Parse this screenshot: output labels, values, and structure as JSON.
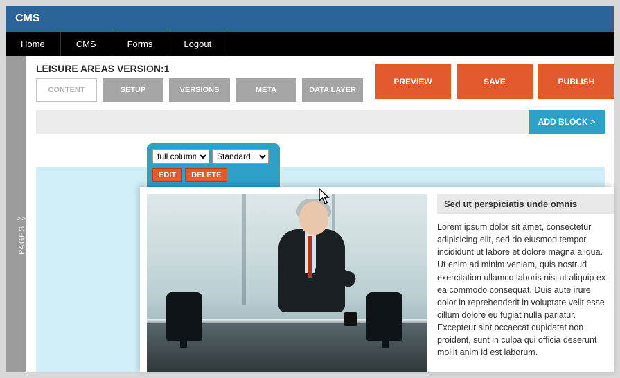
{
  "header": {
    "brand": "CMS"
  },
  "nav": {
    "items": [
      "Home",
      "CMS",
      "Forms",
      "Logout"
    ]
  },
  "sidebar": {
    "pages_label": "PAGES",
    "chevron": ">>"
  },
  "page": {
    "title": "LEISURE AREAS VERSION:1"
  },
  "tabs": {
    "items": [
      "CONTENT",
      "SETUP",
      "VERSIONS",
      "META",
      "DATA LAYER"
    ],
    "active_index": 0
  },
  "actions": {
    "preview": "PREVIEW",
    "save": "SAVE",
    "publish": "PUBLISH"
  },
  "toolbar": {
    "add_block": "ADD BLOCK >"
  },
  "block_editor": {
    "layout_select": "full column",
    "template_select": "Standard",
    "edit": "EDIT",
    "delete": "DELETE"
  },
  "content_block": {
    "heading": "Sed ut perspiciatis unde omnis",
    "body": "Lorem ipsum dolor sit amet, consectetur adipisicing elit, sed do eiusmod tempor incididunt ut labore et dolore magna aliqua. Ut enim ad minim veniam, quis nostrud exercitation ullamco laboris nisi ut aliquip ex ea commodo consequat. Duis aute irure dolor in reprehenderit in voluptate velit esse cillum dolore eu fugiat nulla pariatur. Excepteur sint occaecat cupidatat non proident, sunt in culpa qui officia deserunt mollit anim id est laborum."
  }
}
